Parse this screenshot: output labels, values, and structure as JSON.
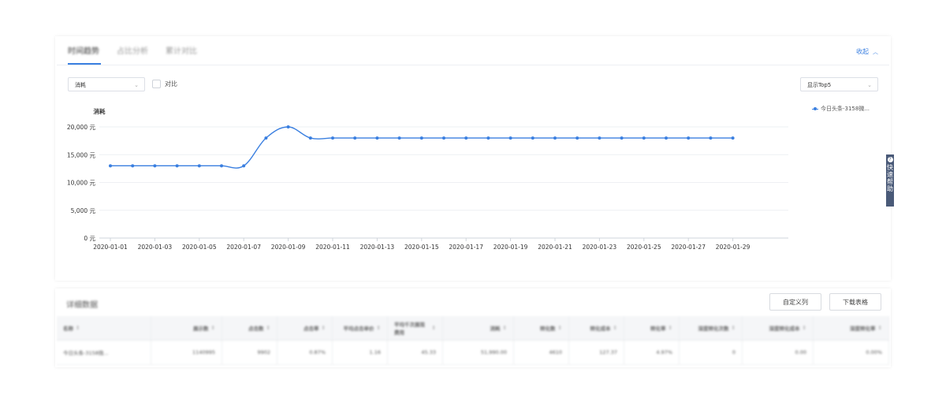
{
  "tabs": [
    {
      "label": "时间趋势",
      "active": true
    },
    {
      "label": "占比分析",
      "active": false
    },
    {
      "label": "累计对比",
      "active": false
    }
  ],
  "collapse_label": "收起",
  "metric_select": {
    "value": "消耗"
  },
  "compare_label": "对比",
  "top_select": {
    "value": "显示Top5"
  },
  "help_tab": {
    "icon": "?",
    "text": "快速帮助"
  },
  "chart_data": {
    "type": "line",
    "title": "",
    "ylabel": "消耗",
    "xlabel": "",
    "ylim": [
      0,
      20000
    ],
    "yticks": [
      "0 元",
      "5,000 元",
      "10,000 元",
      "15,000 元",
      "20,000 元"
    ],
    "yvalues": [
      0,
      5000,
      10000,
      15000,
      20000
    ],
    "xticks": [
      "2020-01-01",
      "2020-01-03",
      "2020-01-05",
      "2020-01-07",
      "2020-01-09",
      "2020-01-11",
      "2020-01-13",
      "2020-01-15",
      "2020-01-17",
      "2020-01-19",
      "2020-01-21",
      "2020-01-23",
      "2020-01-25",
      "2020-01-27",
      "2020-01-29"
    ],
    "x": [
      "2020-01-01",
      "2020-01-02",
      "2020-01-03",
      "2020-01-04",
      "2020-01-05",
      "2020-01-06",
      "2020-01-07",
      "2020-01-08",
      "2020-01-09",
      "2020-01-10",
      "2020-01-11",
      "2020-01-12",
      "2020-01-13",
      "2020-01-14",
      "2020-01-15",
      "2020-01-16",
      "2020-01-17",
      "2020-01-18",
      "2020-01-19",
      "2020-01-20",
      "2020-01-21",
      "2020-01-22",
      "2020-01-23",
      "2020-01-24",
      "2020-01-25",
      "2020-01-26",
      "2020-01-27",
      "2020-01-28",
      "2020-01-29"
    ],
    "series": [
      {
        "name": "今日头条-3158微...",
        "color": "#3a7fe0",
        "values": [
          13000,
          13000,
          13000,
          13000,
          13000,
          13000,
          13000,
          18000,
          20000,
          18000,
          18000,
          18000,
          18000,
          18000,
          18000,
          18000,
          18000,
          18000,
          18000,
          18000,
          18000,
          18000,
          18000,
          18000,
          18000,
          18000,
          18000,
          18000,
          18000
        ]
      }
    ],
    "grid": true,
    "legend": "top-right"
  },
  "table_section": {
    "title": "详细数据",
    "btn_columns": "自定义列",
    "btn_download": "下载表格",
    "headers": [
      "名称",
      "展示数",
      "点击数",
      "点击率",
      "平均点击单价",
      "平均千次展现费用",
      "消耗",
      "转化数",
      "转化成本",
      "转化率",
      "深度转化次数",
      "深度转化成本",
      "深度转化率"
    ],
    "rows": [
      [
        "今日头条-3158微...",
        "1140995",
        "9902",
        "0.87%",
        "1.16",
        "45.33",
        "51,990.00",
        "4610",
        "127.37",
        "4.97%",
        "0",
        "0.00",
        "0.00%"
      ]
    ]
  }
}
